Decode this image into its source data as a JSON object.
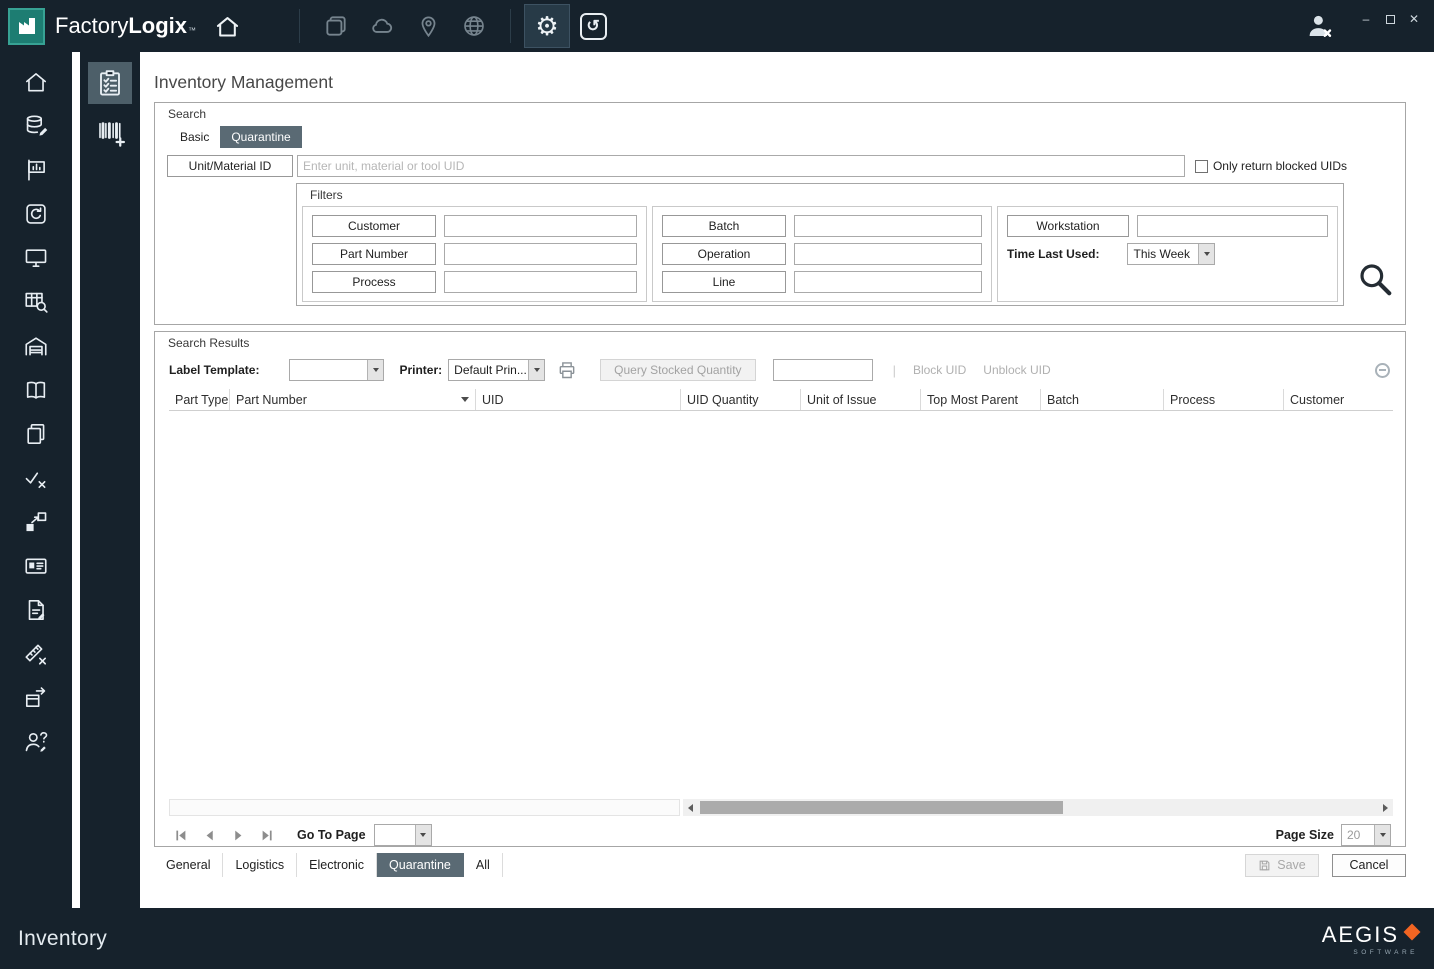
{
  "colors": {
    "topbar_bg": "#16222c",
    "logo_teal": "#1d7d72",
    "active_tab_slate": "#5a6a74",
    "brand_orange": "#f26522"
  },
  "icons": {
    "gear_glyph": "⚙",
    "history_glyph": "↺",
    "minimize_glyph": "–",
    "close_glyph": "✕"
  },
  "titlebar": {
    "brand_factory": "Factory",
    "brand_logix": "Logix",
    "brand_tm": "™"
  },
  "sidebar_icons": [
    "home",
    "materials-database",
    "production-board",
    "repair-restore",
    "workstation-monitor",
    "inventory-table-search",
    "warehouse",
    "documentation-book",
    "copy-pages",
    "validation-check-x",
    "material-transfer",
    "id-card",
    "document-edit",
    "ruler-reject",
    "package-shipping",
    "user-support"
  ],
  "subbar_icons": [
    "audit-checklist",
    "barcode-add"
  ],
  "page_title": "Inventory Management",
  "search": {
    "title": "Search",
    "tabs": [
      {
        "label": "Basic",
        "active": false
      },
      {
        "label": "Quarantine",
        "active": true
      }
    ],
    "unit_material_button": "Unit/Material ID",
    "unit_placeholder": "Enter unit, material or tool UID",
    "only_blocked_label": "Only return blocked UIDs",
    "only_blocked_checked": false,
    "filters": {
      "title": "Filters",
      "col1": [
        {
          "label": "Customer",
          "value": ""
        },
        {
          "label": "Part Number",
          "value": ""
        },
        {
          "label": "Process",
          "value": ""
        }
      ],
      "col2": [
        {
          "label": "Batch",
          "value": ""
        },
        {
          "label": "Operation",
          "value": ""
        },
        {
          "label": "Line",
          "value": ""
        }
      ],
      "workstation_button": "Workstation",
      "workstation_value": "",
      "time_last_used_label": "Time Last Used:",
      "time_last_used_value": "This Week"
    }
  },
  "results": {
    "title": "Search Results",
    "label_template": "Label Template:",
    "label_template_value": "",
    "printer": "Printer:",
    "printer_value": "Default Prin...",
    "query_stocked_quantity": "Query Stocked Quantity",
    "quantity_value": "",
    "block_uid": "Block UID",
    "unblock_uid": "Unblock UID",
    "columns": [
      "Part Type",
      "Part Number",
      "UID",
      "UID Quantity",
      "Unit of Issue",
      "Top Most Parent",
      "Batch",
      "Process",
      "Customer"
    ],
    "sorted_column": "Part Number",
    "rows": []
  },
  "pager": {
    "go_to_page": "Go To Page",
    "go_to_page_value": "",
    "page_size": "Page Size",
    "page_size_value": "20"
  },
  "bottom_tabs": [
    {
      "label": "General",
      "active": false
    },
    {
      "label": "Logistics",
      "active": false
    },
    {
      "label": "Electronic",
      "active": false
    },
    {
      "label": "Quarantine",
      "active": true
    },
    {
      "label": "All",
      "active": false
    }
  ],
  "buttons": {
    "save": "Save",
    "cancel": "Cancel"
  },
  "statusbar": {
    "module": "Inventory",
    "brand": "AEGIS",
    "brand_sub": "SOFTWARE"
  }
}
